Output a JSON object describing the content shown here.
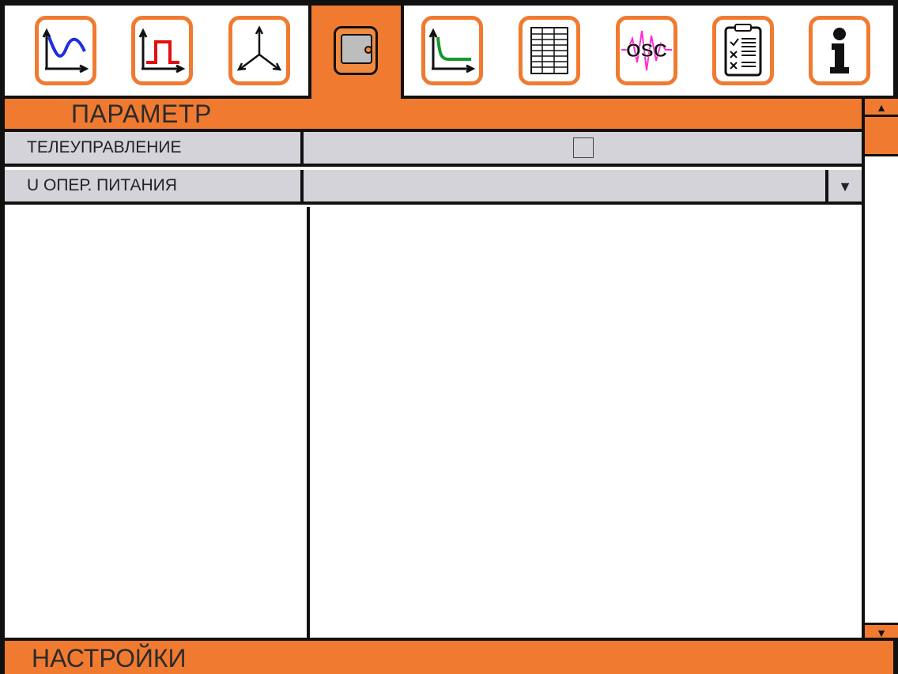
{
  "toolbar": {
    "tabs": [
      {
        "icon": "sine-wave-icon",
        "active": false
      },
      {
        "icon": "pulse-icon",
        "active": false
      },
      {
        "icon": "three-phase-vector-icon",
        "active": false
      },
      {
        "icon": "device-panel-icon",
        "active": true
      },
      {
        "icon": "decay-curve-icon",
        "active": false
      },
      {
        "icon": "table-icon",
        "active": false
      },
      {
        "icon": "oscillogram-icon",
        "active": false,
        "label": "OSC"
      },
      {
        "icon": "checklist-clipboard-icon",
        "active": false
      },
      {
        "icon": "info-icon",
        "active": false
      }
    ]
  },
  "header": {
    "title": "ПАРАМЕТР"
  },
  "rows": [
    {
      "label": "ТЕЛЕУПРАВЛЕНИЕ",
      "type": "checkbox",
      "checked": false
    },
    {
      "label": "U ОПЕР. ПИТАНИЯ",
      "type": "dropdown",
      "value": "",
      "dropdown_icon": "▼"
    }
  ],
  "scrollbar": {
    "up_icon": "▲",
    "down_icon": "▼"
  },
  "footer": {
    "title": "НАСТРОЙКИ"
  },
  "colors": {
    "accent": "#f07a30",
    "row_bg": "#d3d3d9",
    "border": "#111111"
  }
}
